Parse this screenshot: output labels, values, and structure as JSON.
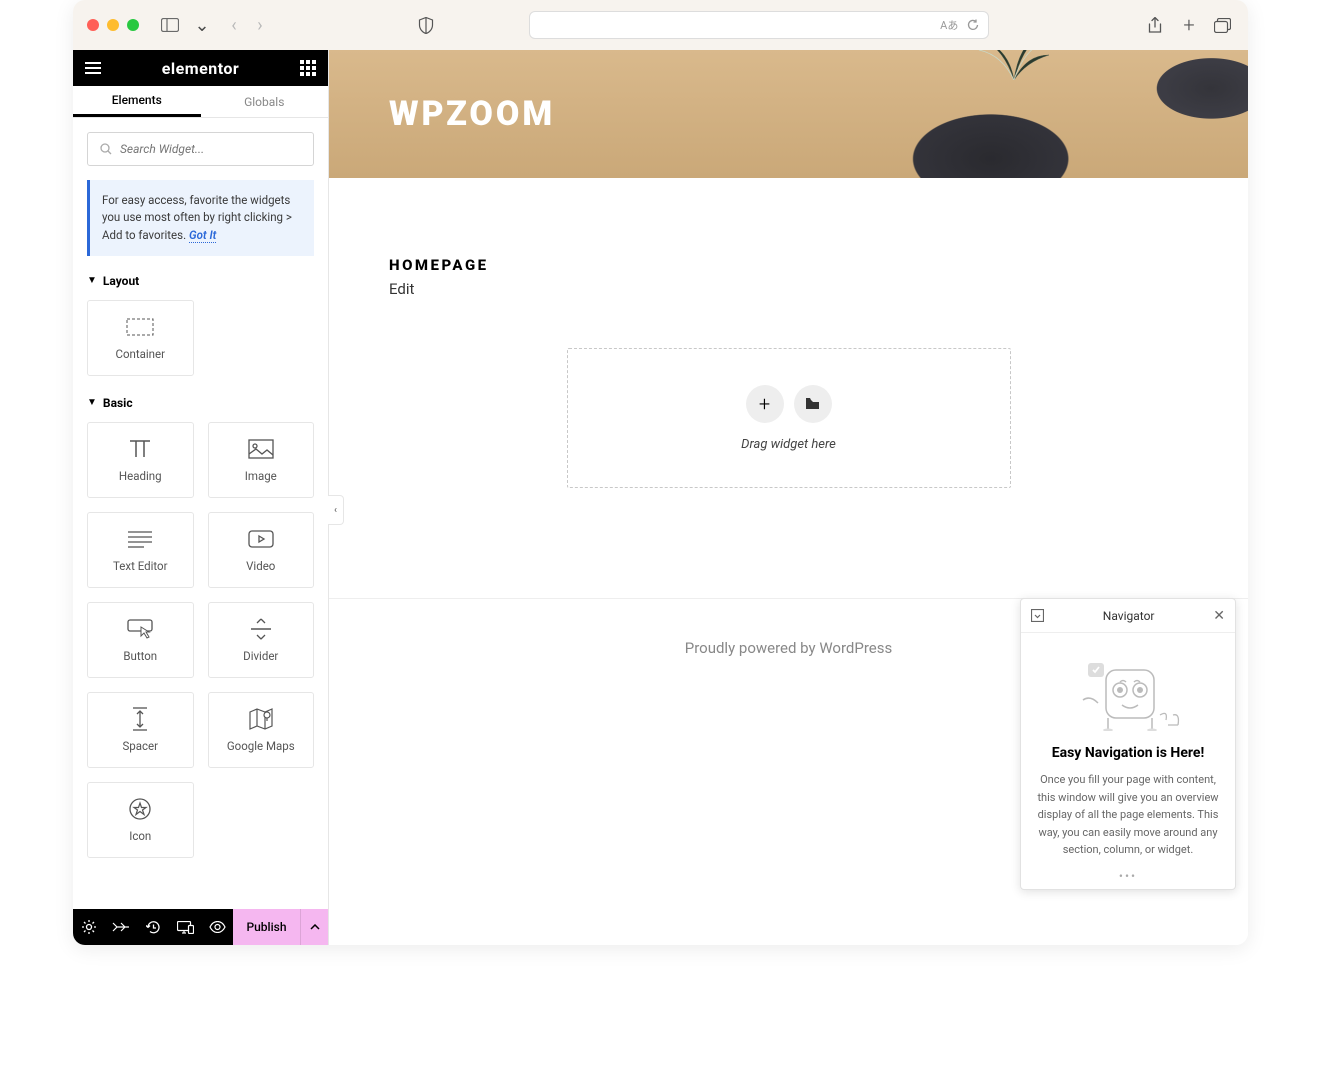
{
  "browser": {
    "translate_label": "Aあ"
  },
  "elementor": {
    "logo": "elementor",
    "tabs": {
      "elements": "Elements",
      "globals": "Globals"
    },
    "search_placeholder": "Search Widget...",
    "tip_text": "For easy access, favorite the widgets you use most often by right clicking > Add to favorites. ",
    "tip_link": "Got It",
    "categories": {
      "layout": {
        "label": "Layout",
        "widgets": [
          {
            "name": "container",
            "label": "Container"
          }
        ]
      },
      "basic": {
        "label": "Basic",
        "widgets": [
          {
            "name": "heading",
            "label": "Heading"
          },
          {
            "name": "image",
            "label": "Image"
          },
          {
            "name": "text-editor",
            "label": "Text Editor"
          },
          {
            "name": "video",
            "label": "Video"
          },
          {
            "name": "button",
            "label": "Button"
          },
          {
            "name": "divider",
            "label": "Divider"
          },
          {
            "name": "spacer",
            "label": "Spacer"
          },
          {
            "name": "google-maps",
            "label": "Google Maps"
          },
          {
            "name": "icon",
            "label": "Icon"
          }
        ]
      }
    },
    "footer": {
      "publish": "Publish"
    }
  },
  "canvas": {
    "site_title": "WPZOOM",
    "page_title": "HOMEPAGE",
    "edit_link": "Edit",
    "drop_hint": "Drag widget here",
    "footer_text": "Proudly powered by WordPress"
  },
  "navigator": {
    "title": "Navigator",
    "heading": "Easy Navigation is Here!",
    "body": "Once you fill your page with content, this window will give you an overview display of all the page elements. This way, you can easily move around any section, column, or widget.",
    "dots": "•••"
  }
}
